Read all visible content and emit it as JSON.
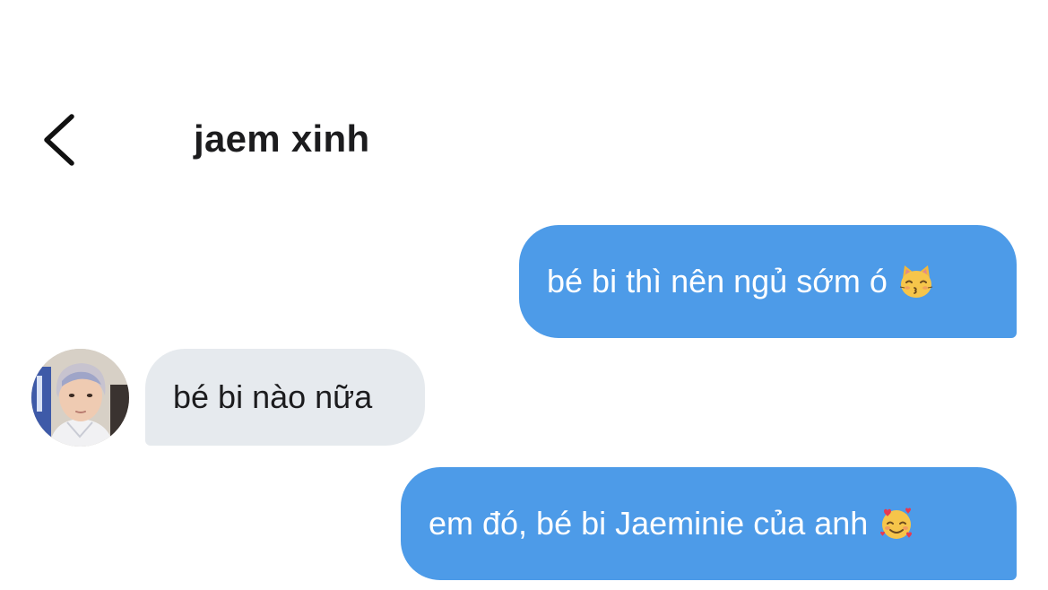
{
  "header": {
    "back_icon": "chevron-left-icon",
    "title": "jaem xinh"
  },
  "messages": [
    {
      "direction": "outgoing",
      "text": "bé bi thì nên ngủ sớm ó",
      "emoji": "kissing-cat-face-icon"
    },
    {
      "direction": "incoming",
      "text": "bé bi nào nữa",
      "avatar": "contact-avatar"
    },
    {
      "direction": "outgoing",
      "text": "em đó, bé bi Jaeminie của anh",
      "emoji": "smiling-face-with-hearts-icon"
    }
  ],
  "colors": {
    "outgoing_bubble": "#4d9be8",
    "incoming_bubble": "#e6eaee",
    "title_text": "#1c1c1e",
    "background": "#ffffff"
  }
}
